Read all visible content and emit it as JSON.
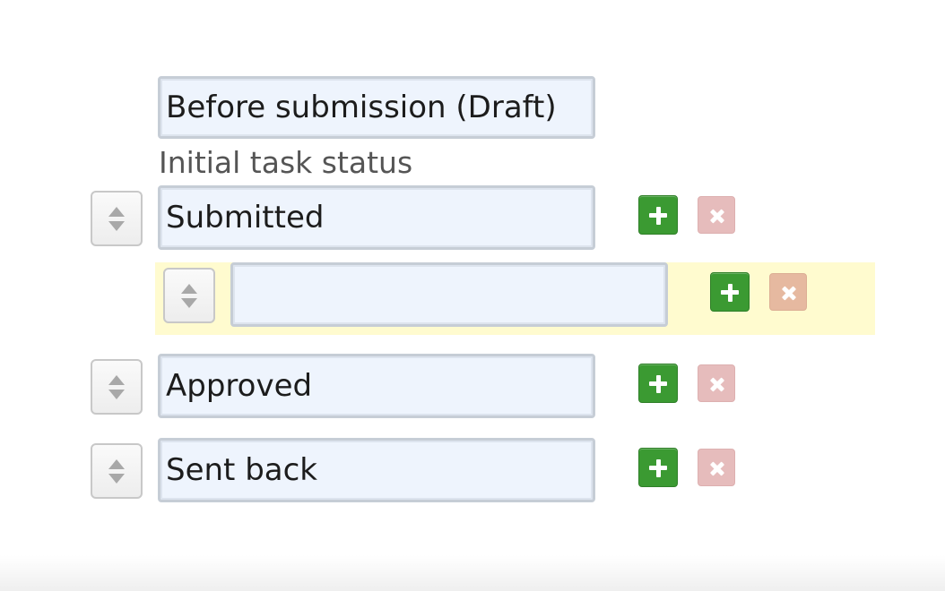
{
  "initial_status": {
    "value": "Before submission (Draft)",
    "label": "Initial task status"
  },
  "status_rows": [
    {
      "value": "Submitted"
    },
    {
      "value": ""
    },
    {
      "value": "Approved"
    },
    {
      "value": "Sent back"
    }
  ],
  "colors": {
    "add_button": "#3b9a32",
    "delete_button_disabled": "#e6bcbc",
    "delete_button_active": "#e6b9a0",
    "new_row_highlight": "#fffbcf",
    "input_background": "#eef4fd"
  },
  "icons": {
    "sort": "sort-arrows-icon",
    "add": "plus-icon",
    "delete": "close-icon"
  }
}
